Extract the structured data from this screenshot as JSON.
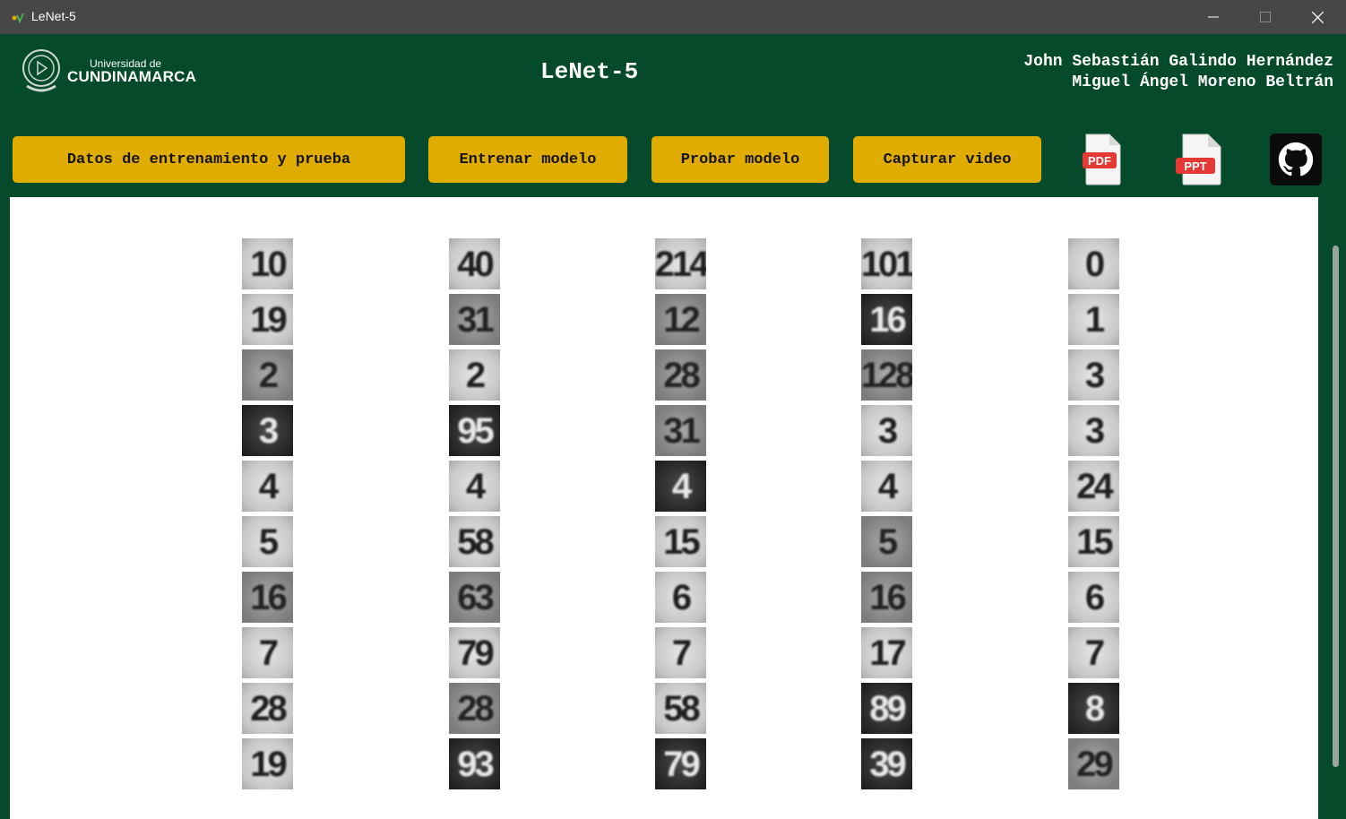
{
  "window": {
    "title": "LeNet-5"
  },
  "header": {
    "logo_line1": "Universidad de",
    "logo_line2": "CUNDINAMARCA",
    "app_title": "LeNet-5",
    "author1": "John Sebastián Galindo Hernández",
    "author2": "Miguel Ángel Moreno Beltrán"
  },
  "toolbar": {
    "data_label": "Datos de entrenamiento y prueba",
    "train_label": "Entrenar modelo",
    "test_label": "Probar modelo",
    "capture_label": "Capturar video",
    "pdf_label": "PDF",
    "ppt_label": "PPT"
  },
  "colors": {
    "background": "#054a2b",
    "button": "#e0ac00",
    "titlebar": "#474747"
  },
  "icons": [
    "app-icon",
    "minimize-icon",
    "maximize-icon",
    "close-icon",
    "pdf-icon",
    "ppt-icon",
    "github-icon"
  ],
  "samples": [
    [
      {
        "text": "10",
        "shade": "light"
      },
      {
        "text": "19",
        "shade": "light"
      },
      {
        "text": "2",
        "shade": "mid"
      },
      {
        "text": "3",
        "shade": "dark"
      },
      {
        "text": "4",
        "shade": "light"
      },
      {
        "text": "5",
        "shade": "light"
      },
      {
        "text": "16",
        "shade": "mid"
      },
      {
        "text": "7",
        "shade": "light"
      },
      {
        "text": "28",
        "shade": "light"
      },
      {
        "text": "19",
        "shade": "light"
      }
    ],
    [
      {
        "text": "40",
        "shade": "light"
      },
      {
        "text": "31",
        "shade": "mid"
      },
      {
        "text": "2",
        "shade": "light"
      },
      {
        "text": "95",
        "shade": "dark"
      },
      {
        "text": "4",
        "shade": "light"
      },
      {
        "text": "58",
        "shade": "light"
      },
      {
        "text": "63",
        "shade": "mid"
      },
      {
        "text": "79",
        "shade": "light"
      },
      {
        "text": "28",
        "shade": "mid"
      },
      {
        "text": "93",
        "shade": "dark"
      }
    ],
    [
      {
        "text": "214",
        "shade": "light"
      },
      {
        "text": "12",
        "shade": "mid"
      },
      {
        "text": "28",
        "shade": "mid"
      },
      {
        "text": "31",
        "shade": "mid"
      },
      {
        "text": "4",
        "shade": "dark"
      },
      {
        "text": "15",
        "shade": "light"
      },
      {
        "text": "6",
        "shade": "light"
      },
      {
        "text": "7",
        "shade": "light"
      },
      {
        "text": "58",
        "shade": "light"
      },
      {
        "text": "79",
        "shade": "dark"
      }
    ],
    [
      {
        "text": "101",
        "shade": "light"
      },
      {
        "text": "16",
        "shade": "dark"
      },
      {
        "text": "128",
        "shade": "mid"
      },
      {
        "text": "3",
        "shade": "light"
      },
      {
        "text": "4",
        "shade": "light"
      },
      {
        "text": "5",
        "shade": "mid"
      },
      {
        "text": "16",
        "shade": "mid"
      },
      {
        "text": "17",
        "shade": "light"
      },
      {
        "text": "89",
        "shade": "dark"
      },
      {
        "text": "39",
        "shade": "dark"
      }
    ],
    [
      {
        "text": "0",
        "shade": "light"
      },
      {
        "text": "1",
        "shade": "light"
      },
      {
        "text": "3",
        "shade": "light"
      },
      {
        "text": "3",
        "shade": "light"
      },
      {
        "text": "24",
        "shade": "light"
      },
      {
        "text": "15",
        "shade": "light"
      },
      {
        "text": "6",
        "shade": "light"
      },
      {
        "text": "7",
        "shade": "light"
      },
      {
        "text": "8",
        "shade": "dark"
      },
      {
        "text": "29",
        "shade": "mid"
      }
    ]
  ]
}
